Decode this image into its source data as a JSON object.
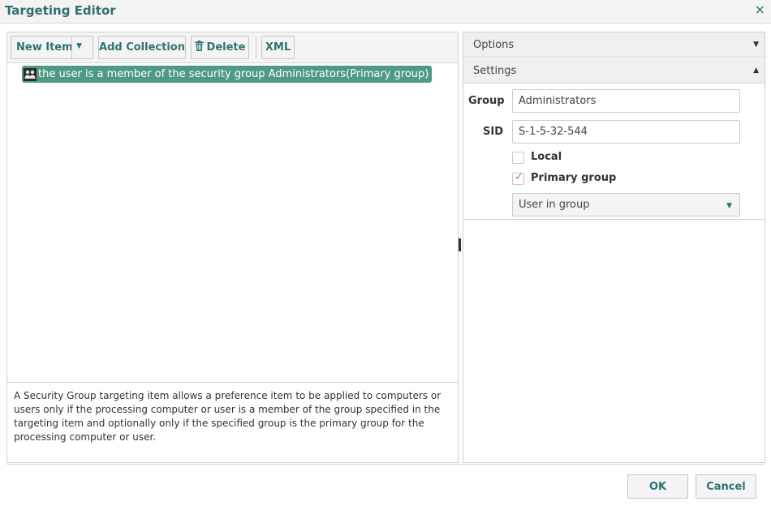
{
  "dialog": {
    "title": "Targeting Editor",
    "close_glyph": "×"
  },
  "toolbar": {
    "new_item_label": "New Item",
    "dropdown_glyph": "▼",
    "add_collection_label": "Add Collection",
    "delete_label": "Delete",
    "xml_label": "XML"
  },
  "tree": {
    "items": [
      {
        "label": "the user is a member of the security group Administrators(Primary group)",
        "icon": "security-group-icon",
        "selected": true
      }
    ]
  },
  "description": "A Security Group targeting item allows a preference item to be applied to computers or users only if the processing computer or user is a member of the group specified in the targeting item and optionally only if the specified group is the primary group for the processing computer or user.",
  "right_panel": {
    "options_label": "Options",
    "settings_label": "Settings",
    "options_caret": "▼",
    "settings_caret": "▲",
    "group_label": "Group",
    "group_value": "Administrators",
    "sid_label": "SID",
    "sid_value": "S-1-5-32-544",
    "local_label": "Local",
    "local_checked": false,
    "primary_group_label": "Primary group",
    "primary_group_checked": true,
    "check_glyph": "✓",
    "mode_value": "User in group",
    "mode_caret": "▼"
  },
  "footer": {
    "ok_label": "OK",
    "cancel_label": "Cancel"
  },
  "colors": {
    "accent": "#2f7373",
    "selection": "#4f9a84",
    "check": "#e06a2a"
  }
}
